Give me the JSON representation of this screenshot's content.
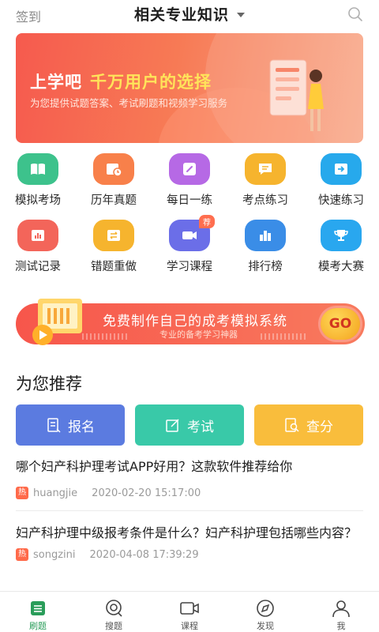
{
  "header": {
    "signin": "签到",
    "title": "相关专业知识",
    "icons": {
      "search": "search-icon",
      "dropdown": "chevron-down-icon"
    }
  },
  "banner": {
    "title_prefix": "上学吧",
    "title_highlight": "千万用户的选择",
    "subtitle": "为您提供试题答案、考试刷题和视频学习服务"
  },
  "grid": {
    "row1": [
      {
        "label": "模拟考场",
        "icon": "book-icon",
        "color": "#3dc28c"
      },
      {
        "label": "历年真题",
        "icon": "calendar-icon",
        "color": "#f8804a"
      },
      {
        "label": "每日一练",
        "icon": "pencil-icon",
        "color": "#b669e5"
      },
      {
        "label": "考点练习",
        "icon": "chat-icon",
        "color": "#f6b42e"
      },
      {
        "label": "快速练习",
        "icon": "arrow-icon",
        "color": "#27a9ec"
      }
    ],
    "row2": [
      {
        "label": "测试记录",
        "icon": "chart-icon",
        "color": "#f3655a"
      },
      {
        "label": "错题重做",
        "icon": "swap-icon",
        "color": "#f6b42e"
      },
      {
        "label": "学习课程",
        "icon": "video-icon",
        "color": "#6b6ee8",
        "badge": "荐"
      },
      {
        "label": "排行榜",
        "icon": "bar-icon",
        "color": "#3a8de7"
      },
      {
        "label": "模考大赛",
        "icon": "trophy-icon",
        "color": "#29a7ef"
      }
    ]
  },
  "promo": {
    "title": "免费制作自己的成考模拟系统",
    "subtitle": "专业的备考学习神器",
    "go": "GO"
  },
  "recommend": {
    "title": "为您推荐",
    "buttons": {
      "signup": "报名",
      "exam": "考试",
      "score": "查分"
    },
    "colors": {
      "signup": "#5b7be0",
      "exam": "#39c9a8",
      "score": "#f9bd3c"
    }
  },
  "articles": [
    {
      "title": "哪个妇产科护理考试APP好用？这款软件推荐给你",
      "tag": "热",
      "author": "huangjie",
      "time": "2020-02-20 15:17:00"
    },
    {
      "title": "妇产科护理中级报考条件是什么？妇产科护理包括哪些内容？",
      "tag": "热",
      "author": "songzini",
      "time": "2020-04-08 17:39:29"
    }
  ],
  "tabbar": {
    "home": "刷题",
    "search": "搜题",
    "course": "课程",
    "discover": "发现",
    "me": "我",
    "active_color": "#2a9d5a"
  }
}
